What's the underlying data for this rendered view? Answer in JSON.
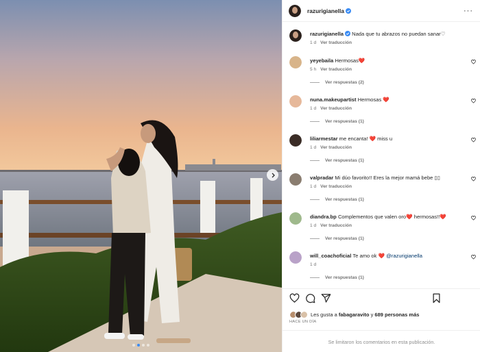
{
  "post": {
    "username": "razurigianella",
    "verified": true,
    "caption_user": "razurigianella",
    "caption_text": "Nada que tu abrazos no puedan sanar♡",
    "caption_time": "1 d",
    "translate_label": "Ver traducción",
    "photo_dots": 4,
    "photo_active_dot": 1
  },
  "comments": [
    {
      "user": "yeyebaila",
      "text": "Hermosas❤️",
      "time": "5 h",
      "translate": "Ver traducción",
      "replies": "Ver respuestas (2)",
      "avatar_color": "#d8b48a"
    },
    {
      "user": "nuna.makeupartist",
      "text": "Hermosas ❤️",
      "time": "1 d",
      "translate": "Ver traducción",
      "replies": "Ver respuestas (1)",
      "avatar_color": "#e6b89a"
    },
    {
      "user": "liliarmestar",
      "text": "me encanta! ❤️ miss u",
      "time": "1 d",
      "translate": "Ver traducción",
      "replies": "Ver respuestas (1)",
      "avatar_color": "#3a2c26"
    },
    {
      "user": "valpradar",
      "text": "Mi dúo favorito!! Eres la mejor mamá bebe ▯▯",
      "time": "1 d",
      "translate": "Ver traducción",
      "replies": "Ver respuestas (1)",
      "avatar_color": "#8a7d70"
    },
    {
      "user": "diandra.bp",
      "text": "Complementos que valen oro❤️ hermosas!!❤️",
      "time": "1 d",
      "translate": "Ver traducción",
      "replies": "Ver respuestas (1)",
      "avatar_color": "#9fb98c"
    },
    {
      "user": "will_coachoficial",
      "text": "Te amo ok ❤️",
      "mention": "@razurigianella",
      "time": "1 d",
      "translate": "",
      "replies": "Ver respuestas (1)",
      "avatar_color": "#b9a2c8"
    }
  ],
  "actions": {
    "icons": [
      "heart-icon",
      "comment-icon",
      "share-icon",
      "bookmark-icon"
    ],
    "likes_prefix": "Les gusta a ",
    "likes_user": "fabagaravito",
    "likes_middle": " y ",
    "likes_count": "689 personas más",
    "time_ago": "HACE UN DÍA",
    "comments_closed": "Se limitaron los comentarios en esta publicación."
  },
  "colors": {
    "accent_blue": "#3b8cf4",
    "heart_red": "#e0245e",
    "meta_gray": "#737373"
  }
}
